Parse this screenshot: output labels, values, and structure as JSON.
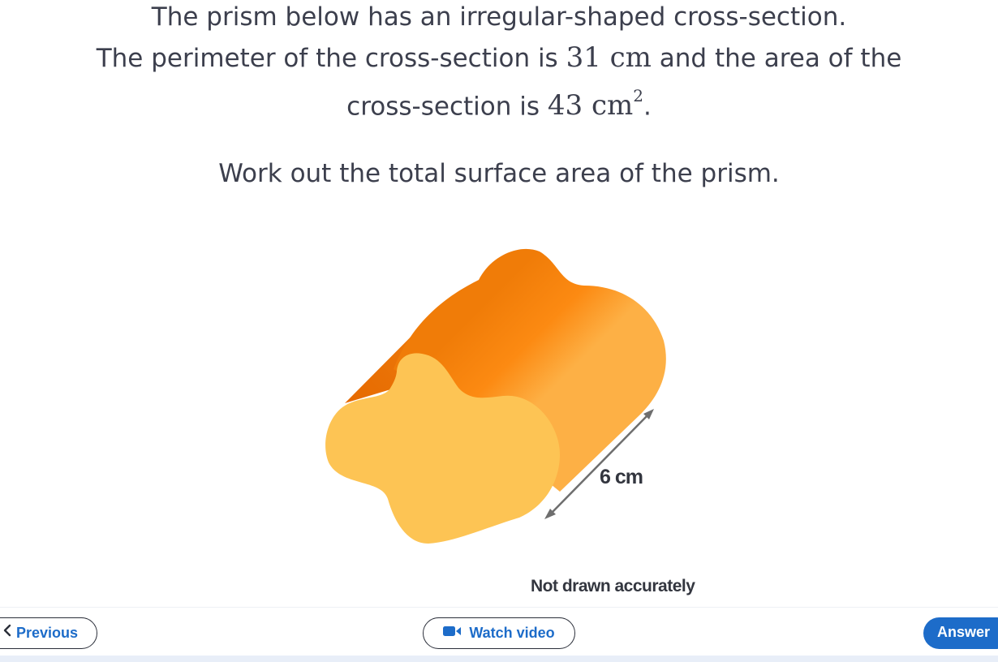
{
  "question": {
    "line1": "The prism below has an irregular-shaped cross-section.",
    "line2_before": "The perimeter of the cross-section is ",
    "perimeter_value": "31",
    "perimeter_unit": "cm",
    "line2_after": " and the area of the",
    "line3_before": "cross-section is ",
    "area_value": "43",
    "area_unit": "cm",
    "area_exponent": "2",
    "line3_after": ".",
    "task": "Work out the total surface area of the prism."
  },
  "figure": {
    "length_label": "6 cm",
    "note": "Not drawn accurately",
    "colors": {
      "face": "#FDC454",
      "body_dark": "#E66A00",
      "body_mid": "#FC8A12",
      "body_light": "#FDB045",
      "arrow": "#6e6e6e"
    }
  },
  "nav": {
    "previous_label": "Previous",
    "video_label": "Watch video",
    "answer_label": "Answer"
  },
  "colors": {
    "accent": "#1D6CC9",
    "text": "#3C3F4D"
  }
}
